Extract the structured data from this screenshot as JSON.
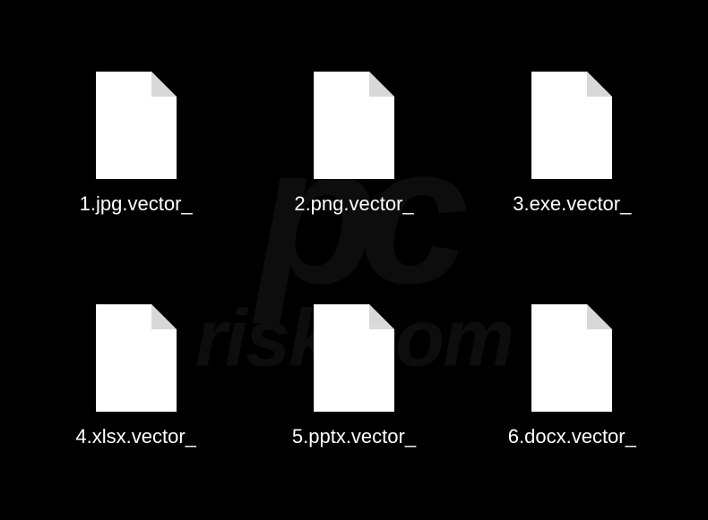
{
  "files": [
    {
      "name": "1.jpg.vector_"
    },
    {
      "name": "2.png.vector_"
    },
    {
      "name": "3.exe.vector_"
    },
    {
      "name": "4.xlsx.vector_"
    },
    {
      "name": "5.pptx.vector_"
    },
    {
      "name": "6.docx.vector_"
    }
  ],
  "watermark": {
    "logo": "pc",
    "text": "risk.com"
  }
}
